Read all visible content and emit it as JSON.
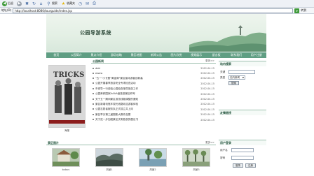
{
  "browser": {
    "back_label": "后退",
    "search_label": "搜索",
    "favorites_label": "收藏夹",
    "address_label": "地址(D)",
    "address_value": "http://localhost:8080/tourguide/index.jsp",
    "go_label": "转到"
  },
  "banner": {
    "title": "公园导游系统"
  },
  "nav": {
    "items": [
      "首页",
      "公园简介",
      "景点介绍",
      "游玩攻略",
      "景区地图",
      "新闻公告",
      "图片欣赏",
      "视频展示",
      "留言板",
      "联系我们",
      "用户注册"
    ]
  },
  "news": {
    "title": "公园新闻",
    "more": "更多>>",
    "photo_caption": "海报",
    "items": [
      {
        "text": "ddd",
        "date": "2012-04-15"
      },
      {
        "text": "ewew",
        "date": "2012-04-15"
      },
      {
        "text": "\"五一\"小长假\"黄金周\"景区接待游客创新高",
        "date": "2012-04-15"
      },
      {
        "text": "公园开展春季旅游安全专项检查活动",
        "date": "2012-04-15"
      },
      {
        "text": "市领导一行莅临公园检查指导旅游工作",
        "date": "2012-04-15"
      },
      {
        "text": "公园荣获国家AAAA级旅游景区称号",
        "date": "2012-04-15"
      },
      {
        "text": "关于五一期间景区游览线路调整的通知",
        "date": "2012-04-15"
      },
      {
        "text": "景区新增电瓶车观光线路欢迎游客体验",
        "date": "2012-04-15"
      },
      {
        "text": "公园志愿者服务队正式成立并上岗",
        "date": "2012-04-15"
      },
      {
        "text": "景区举办第三届摄影大赛作品展",
        "date": "2012-04-15"
      },
      {
        "text": "关于进一步加强景区文明旅游的倡议书",
        "date": "2012-04-15"
      }
    ]
  },
  "scenic": {
    "title": "景区图片",
    "more": "更多>>",
    "items": [
      {
        "caption": "bvbvv"
      },
      {
        "caption": "风景1"
      },
      {
        "caption": "风景2"
      },
      {
        "caption": "风景3"
      }
    ]
  },
  "sidebar": {
    "search": {
      "title": "站内搜索",
      "keyword_label": "关键",
      "type_label": "类型",
      "type_value": "站内新闻",
      "button": "搜索"
    },
    "links": {
      "title": "友情链接"
    },
    "login": {
      "title": "用户登录",
      "user_label": "用户名",
      "pass_label": "密码",
      "login_button": "登录",
      "register_button": "注册"
    }
  },
  "colors": {
    "nav_bg": "#5f9e83",
    "accent": "#2c5b45"
  }
}
